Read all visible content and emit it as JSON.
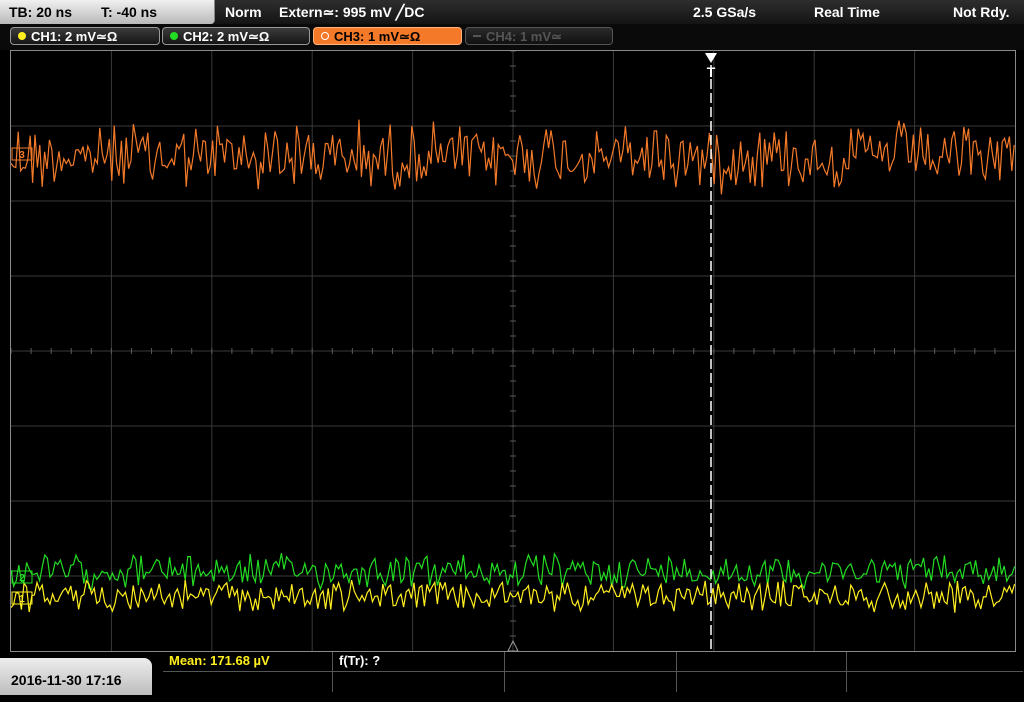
{
  "topbar": {
    "timebase": "TB: 20 ns",
    "trigger_time": "T: -40 ns",
    "acq_mode": "Norm",
    "trigger": "Extern≃: 995 mV ╱DC",
    "sample_rate": "2.5 GSa/s",
    "mode": "Real Time",
    "status": "Not Rdy."
  },
  "channels": [
    {
      "label": "CH1: 2 mV≃Ω",
      "color": "#ffef1f",
      "active": true
    },
    {
      "label": "CH2: 2 mV≃Ω",
      "color": "#22dd22",
      "active": true
    },
    {
      "label": "CH3: 1 mV≃Ω",
      "color": "#f47a2a",
      "active": true,
      "selected": true
    },
    {
      "label": "CH4: 1 mV≃",
      "color": "#555555",
      "active": false
    }
  ],
  "markers": {
    "trigger_marker": "T",
    "ch3_marker": "3",
    "ch2_marker": "2",
    "ch1_marker": "1"
  },
  "bottombar": {
    "datetime": "2016-11-30 17:16",
    "mean": "Mean: 171.68 µV",
    "freq": "f(Tr): ?"
  },
  "colors": {
    "ch1": "#ffef1f",
    "ch2": "#22dd22",
    "ch3": "#f47a2a",
    "grid": "#3a3a3a"
  }
}
